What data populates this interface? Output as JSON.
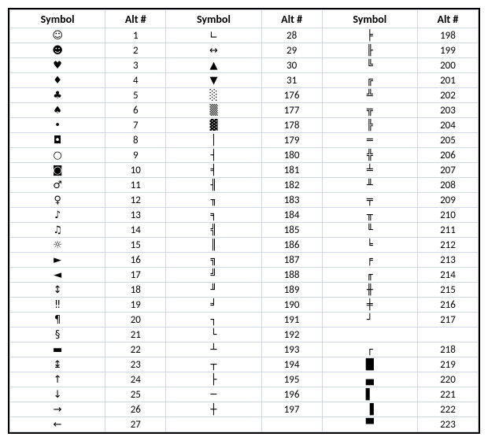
{
  "headers": [
    "Symbol",
    "Alt #",
    "Symbol",
    "Alt #",
    "Symbol",
    "Alt #"
  ],
  "chart_data": {
    "type": "table",
    "title": "Alt codes for special symbols",
    "columns": [
      "Symbol",
      "Alt #",
      "Symbol",
      "Alt #",
      "Symbol",
      "Alt #"
    ]
  },
  "rows": [
    {
      "s1": "☺",
      "a1": "1",
      "s2": "∟",
      "a2": "28",
      "s3": "╞",
      "a3": "198"
    },
    {
      "s1": "☻",
      "a1": "2",
      "s2": "↔",
      "a2": "29",
      "s3": "╟",
      "a3": "199"
    },
    {
      "s1": "♥",
      "a1": "3",
      "s2": "▲",
      "a2": "30",
      "s3": "╚",
      "a3": "200"
    },
    {
      "s1": "♦",
      "a1": "4",
      "s2": "▼",
      "a2": "31",
      "s3": "╔",
      "a3": "201"
    },
    {
      "s1": "♣",
      "a1": "5",
      "s2": "░",
      "a2": "176",
      "s3": "╩",
      "a3": "202"
    },
    {
      "s1": "♠",
      "a1": "6",
      "s2": "▒",
      "a2": "177",
      "s3": "╦",
      "a3": "203"
    },
    {
      "s1": "•",
      "a1": "7",
      "s2": "▓",
      "a2": "178",
      "s3": "╠",
      "a3": "204"
    },
    {
      "s1": "◘",
      "a1": "8",
      "s2": "│",
      "a2": "179",
      "s3": "═",
      "a3": "205"
    },
    {
      "s1": "○",
      "a1": "9",
      "s2": "┤",
      "a2": "180",
      "s3": "╬",
      "a3": "206"
    },
    {
      "s1": "◙",
      "a1": "10",
      "s2": "╡",
      "a2": "181",
      "s3": "╧",
      "a3": "207"
    },
    {
      "s1": "♂",
      "a1": "11",
      "s2": "╢",
      "a2": "182",
      "s3": "╨",
      "a3": "208"
    },
    {
      "s1": "♀",
      "a1": "12",
      "s2": "╖",
      "a2": "183",
      "s3": "╤",
      "a3": "209"
    },
    {
      "s1": "♪",
      "a1": "13",
      "s2": "╕",
      "a2": "184",
      "s3": "╥",
      "a3": "210"
    },
    {
      "s1": "♫",
      "a1": "14",
      "s2": "╣",
      "a2": "185",
      "s3": "╙",
      "a3": "211"
    },
    {
      "s1": "☼",
      "a1": "15",
      "s2": "║",
      "a2": "186",
      "s3": "╘",
      "a3": "212"
    },
    {
      "s1": "►",
      "a1": "16",
      "s2": "╗",
      "a2": "187",
      "s3": "╒",
      "a3": "213"
    },
    {
      "s1": "◄",
      "a1": "17",
      "s2": "╝",
      "a2": "188",
      "s3": "╓",
      "a3": "214"
    },
    {
      "s1": "↕",
      "a1": "18",
      "s2": "╜",
      "a2": "189",
      "s3": "╫",
      "a3": "215"
    },
    {
      "s1": "‼",
      "a1": "19",
      "s2": "╛",
      "a2": "190",
      "s3": "╪",
      "a3": "216"
    },
    {
      "s1": "¶",
      "a1": "20",
      "s2": "┐",
      "a2": "191",
      "s3": "┘",
      "a3": "217"
    },
    {
      "s1": "§",
      "a1": "21",
      "s2": "└",
      "a2": "192",
      "s3": "",
      "a3": ""
    },
    {
      "s1": "▬",
      "a1": "22",
      "s2": "┴",
      "a2": "193",
      "s3": "┌",
      "a3": "218"
    },
    {
      "s1": "↨",
      "a1": "23",
      "s2": "┬",
      "a2": "194",
      "s3": "█",
      "a3": "219"
    },
    {
      "s1": "↑",
      "a1": "24",
      "s2": "├",
      "a2": "195",
      "s3": "▄",
      "a3": "220"
    },
    {
      "s1": "↓",
      "a1": "25",
      "s2": "─",
      "a2": "196",
      "s3": "▌",
      "a3": "221"
    },
    {
      "s1": "→",
      "a1": "26",
      "s2": "┼",
      "a2": "197",
      "s3": "▐",
      "a3": "222"
    },
    {
      "s1": "←",
      "a1": "27",
      "s2": "",
      "a2": "",
      "s3": "▀",
      "a3": "223"
    }
  ]
}
